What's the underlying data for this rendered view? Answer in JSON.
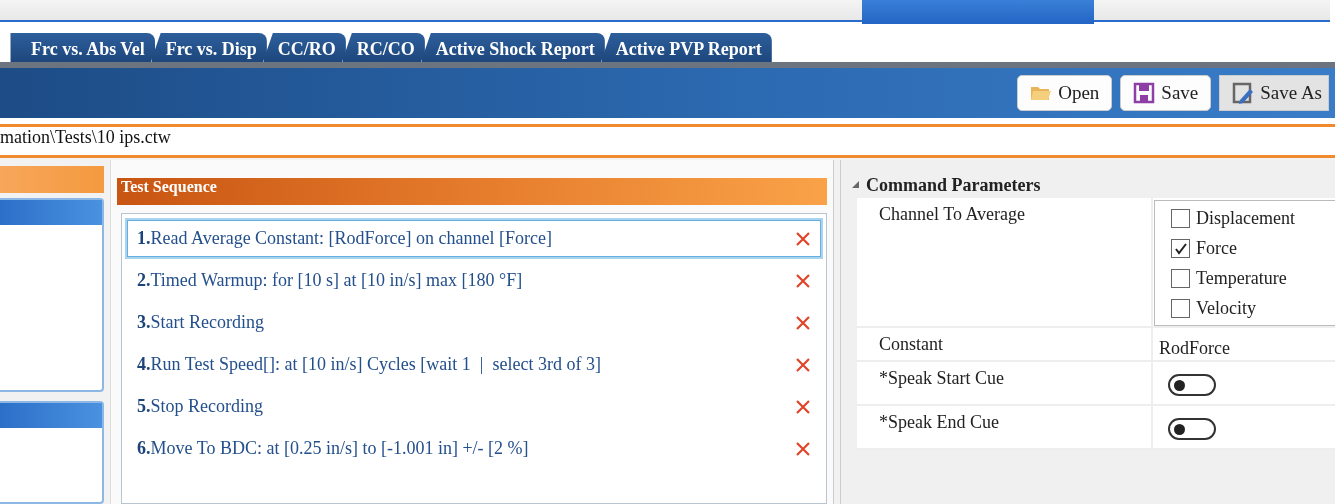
{
  "tabs": [
    {
      "label": "Frc vs. Abs Vel",
      "selected": false
    },
    {
      "label": "Frc vs. Disp",
      "selected": false
    },
    {
      "label": "CC/RO",
      "selected": false
    },
    {
      "label": "RC/CO",
      "selected": false
    },
    {
      "label": "Active Shock Report",
      "selected": false
    },
    {
      "label": "Active PVP Report",
      "selected": false
    }
  ],
  "toolbar": {
    "buttons": [
      {
        "label": "Open",
        "kind": "open",
        "selected": false
      },
      {
        "label": "Save",
        "kind": "save",
        "selected": false
      },
      {
        "label": "Save As",
        "kind": "save-as",
        "selected": true
      }
    ]
  },
  "file_path": "mation\\Tests\\10 ips.ctw",
  "test_sequence": {
    "title": "Test Sequence",
    "steps": [
      {
        "number": "1.",
        "text": "Read Average Constant: [RodForce] on channel [Force]",
        "selected": true
      },
      {
        "number": "2.",
        "text": "Timed Warmup: for [10 s] at [10 in/s] max [180 °F]",
        "selected": false
      },
      {
        "number": "3.",
        "text": "Start Recording",
        "selected": false
      },
      {
        "number": "4.",
        "text": "Run Test Speed[]: at [10 in/s] Cycles [wait 1  |  select 3rd of 3]",
        "selected": false
      },
      {
        "number": "5.",
        "text": "Stop Recording",
        "selected": false
      },
      {
        "number": "6.",
        "text": "Move To BDC: at [0.25 in/s] to [-1.001 in] +/- [2 %]",
        "selected": false
      }
    ]
  },
  "command_parameters": {
    "title": "Command Parameters",
    "expanded": true,
    "rows": [
      {
        "kind": "checklist",
        "label": "Channel To Average",
        "options": [
          {
            "label": "Displacement",
            "checked": false
          },
          {
            "label": "Force",
            "checked": true
          },
          {
            "label": "Temperature",
            "checked": false
          },
          {
            "label": "Velocity",
            "checked": false
          }
        ]
      },
      {
        "kind": "text",
        "label": "Constant",
        "value": "RodForce"
      },
      {
        "kind": "toggle",
        "label": "*Speak Start Cue",
        "on": false
      },
      {
        "kind": "toggle",
        "label": "*Speak End Cue",
        "on": false
      }
    ]
  }
}
